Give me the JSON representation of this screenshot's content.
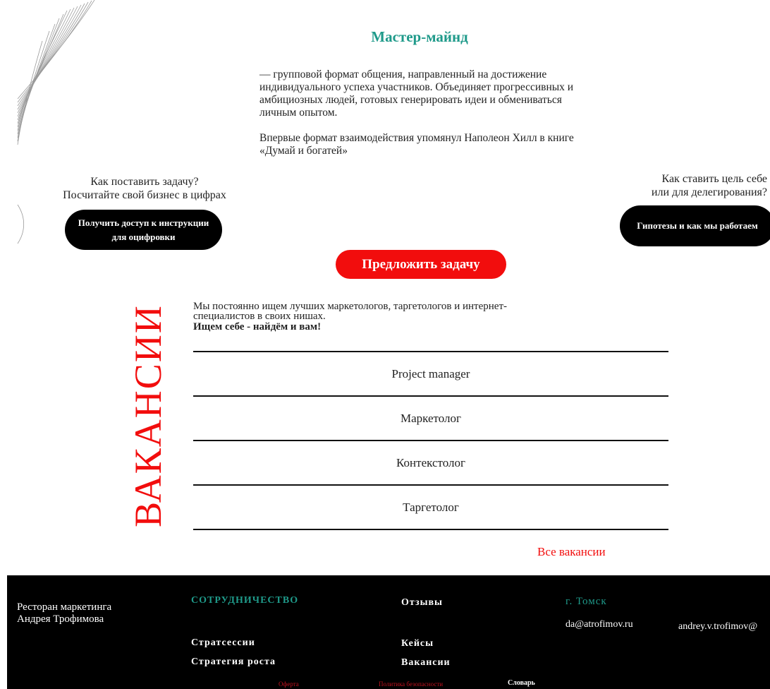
{
  "mastermind": {
    "title": "Мастер-майнд",
    "paragraph1": "— групповой формат общения, направленный на достижение индивидуального успеха участников. Объединяет прогрессивных и амбициозных людей, готовых генерировать идеи и обмениваться личным опытом.",
    "paragraph2": "Впервые формат взаимодействия упомянул Наполеон Хилл в книге «Думай и богатей»"
  },
  "left_block": {
    "question_line1": "Как поставить задачу?",
    "question_line2": "Посчитайте свой бизнес в цифрах",
    "button_line1": "Получить доступ к инструкции",
    "button_line2": "для оцифровки"
  },
  "right_block": {
    "question_line1": "Как ставить цель себе",
    "question_line2": "или для делегирования?",
    "button_label": "Гипотезы и как мы работаем"
  },
  "cta": {
    "label": "Предложить задачу"
  },
  "vacancies": {
    "vertical_title": "ВАКАНСИИ",
    "intro_line1": "Мы постоянно ищем лучших маркетологов, таргетологов и интернет-",
    "intro_line2": "специалистов в своих нишах.",
    "intro_bold": "Ищем себе - найдём и вам!",
    "items": [
      "Project manager",
      "Маркетолог",
      "Контекстолог",
      "Таргетолог"
    ],
    "all_link": "Все вакансии"
  },
  "footer": {
    "brand_line1": "Ресторан маркетинга",
    "brand_line2": "Андрея Трофимова",
    "cooperation": "СОТРУДНИЧЕСТВО",
    "strategy_sessions": "Стратсессии",
    "growth_strategy": "Стратегия роста",
    "reviews": "Отзывы",
    "cases": "Кейсы",
    "vacancies": "Вакансии",
    "city": "г. Томск",
    "email1": "da@atrofimov.ru",
    "email2": "andrey.v.trofimov@",
    "offer": "Оферта",
    "privacy": "Политика безопасности",
    "dictionary": "Словарь"
  },
  "colors": {
    "accent_teal": "#1f9a8a",
    "accent_red": "#f20d0d",
    "footer_bg": "#000000"
  }
}
